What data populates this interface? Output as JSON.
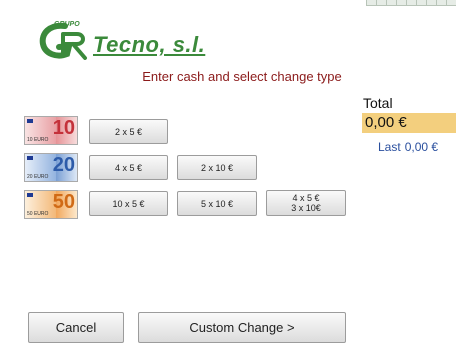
{
  "brand": {
    "grupo": "GRUPO",
    "name": "Tecno, s.l.",
    "colors": {
      "green": "#3b8a3b"
    }
  },
  "header": {
    "instruction": "Enter cash and select change type"
  },
  "total": {
    "label": "Total",
    "amount": "0,00 €",
    "last_label": "Last",
    "last_amount": "0,00 €"
  },
  "notes": [
    {
      "denomination": "10",
      "caption": "10 EURO",
      "options": [
        {
          "label": "2 x 5 €"
        }
      ]
    },
    {
      "denomination": "20",
      "caption": "20 EURO",
      "options": [
        {
          "label": "4 x 5 €"
        },
        {
          "label": "2 x 10 €"
        }
      ]
    },
    {
      "denomination": "50",
      "caption": "50 EURO",
      "options": [
        {
          "label": "10 x 5 €"
        },
        {
          "label": "5 x 10 €"
        },
        {
          "lines": [
            "4 x 5 €",
            "3 x 10€"
          ]
        }
      ]
    }
  ],
  "footer": {
    "cancel_label": "Cancel",
    "custom_label": "Custom Change >"
  },
  "colors": {
    "instruction": "#8b1a1a",
    "total_box": "#f3cf7e",
    "last_text": "#2a4f9e"
  }
}
